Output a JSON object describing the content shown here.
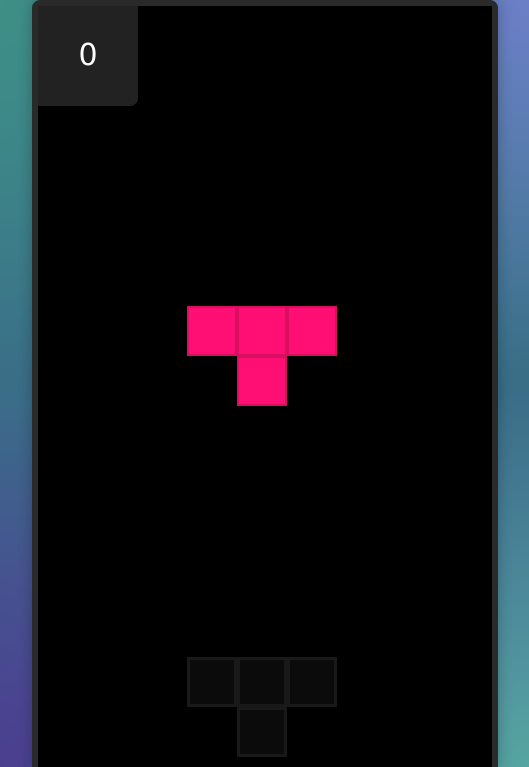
{
  "game": {
    "score": "0"
  },
  "active_piece": {
    "shape": "T",
    "color": "#ff0f73",
    "edge_color": "#d6105f"
  },
  "ghost_piece": {
    "shape": "T",
    "color": "#0b0b0b",
    "edge_color": "#191919"
  },
  "colors": {
    "board": "#000000",
    "frame": "#2a2a2a",
    "score_panel": "#222222",
    "score_text": "#ffffff"
  }
}
